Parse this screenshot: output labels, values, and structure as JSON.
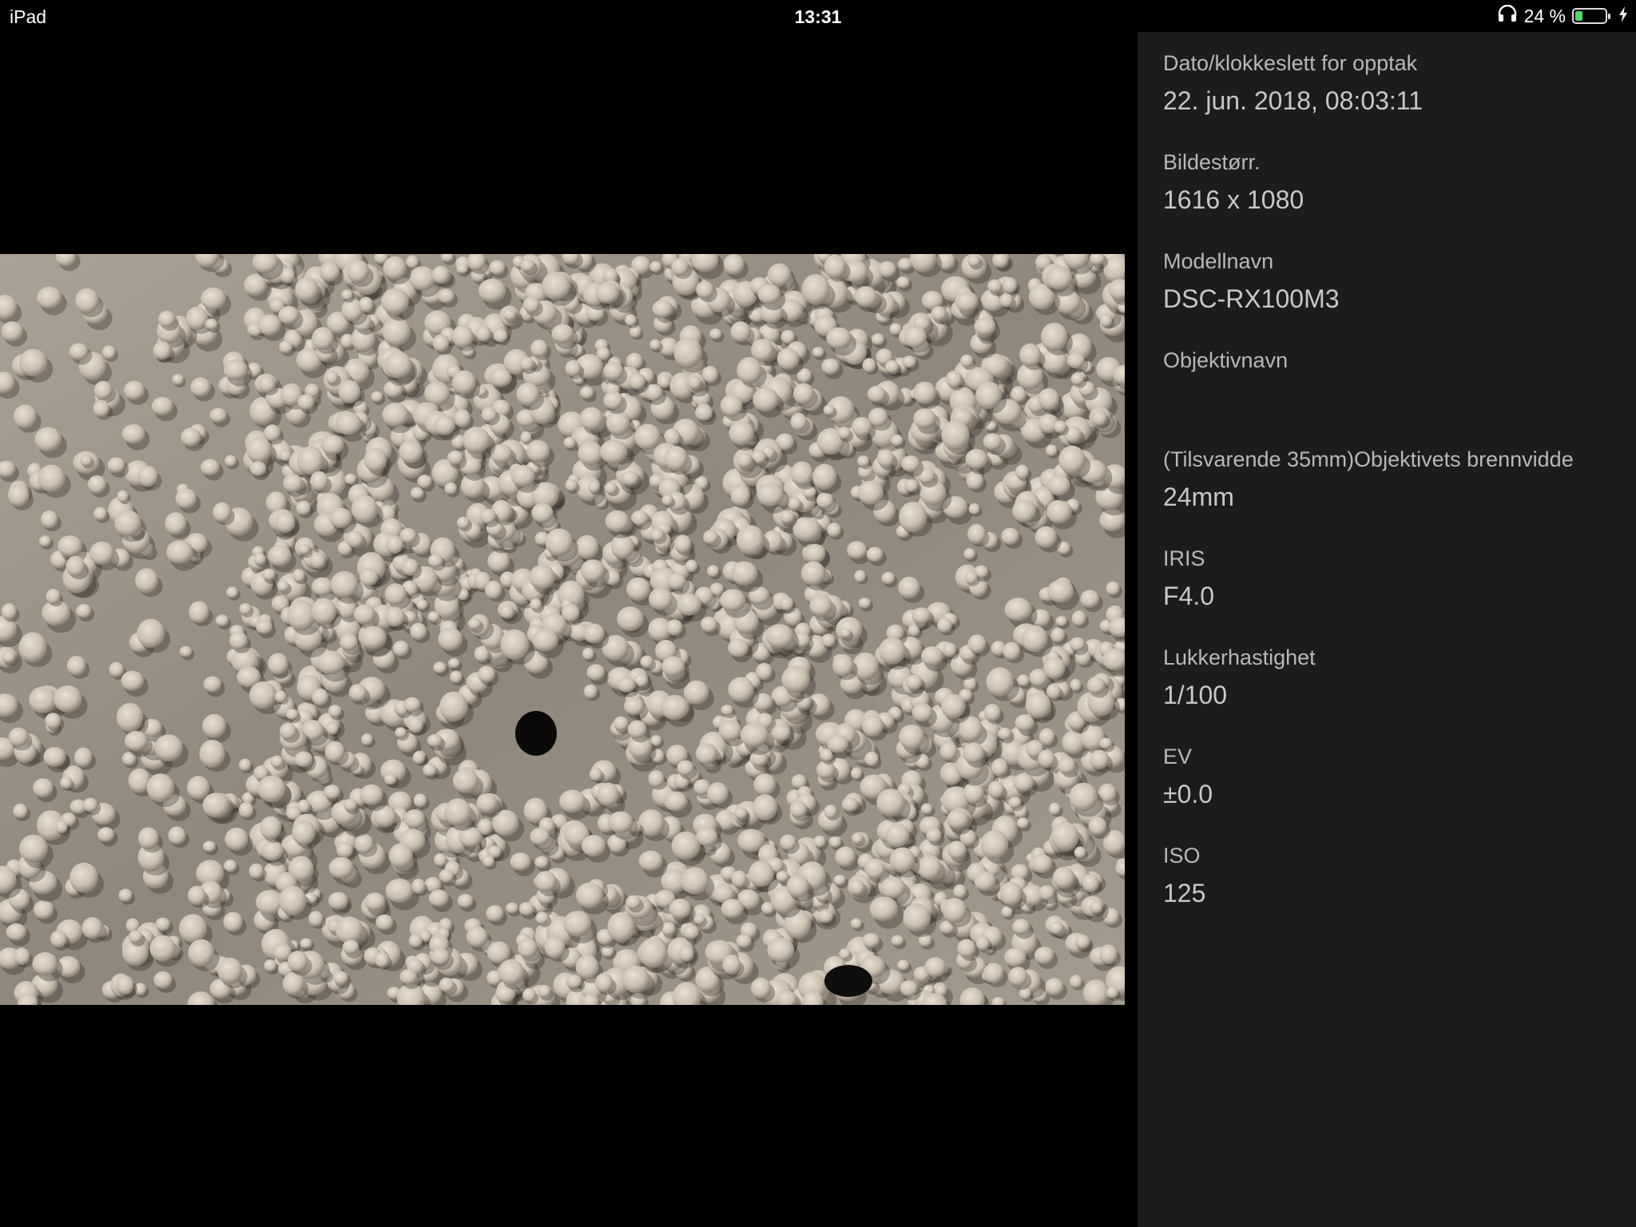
{
  "status_bar": {
    "device": "iPad",
    "time": "13:31",
    "battery_percent_label": "24 %",
    "battery_level": 0.24,
    "battery_color": "#4cd964"
  },
  "photo": {
    "description_icon": "photo-image"
  },
  "info": {
    "items": [
      {
        "label": "Dato/klokkeslett for opptak",
        "value": "22. jun. 2018, 08:03:11"
      },
      {
        "label": "Bildestørr.",
        "value": "1616 x 1080"
      },
      {
        "label": "Modellnavn",
        "value": "DSC-RX100M3"
      },
      {
        "label": "Objektivnavn",
        "value": ""
      },
      {
        "label": "(Tilsvarende 35mm)Objektivets brennvidde",
        "value": "24mm"
      },
      {
        "label": "IRIS",
        "value": "F4.0"
      },
      {
        "label": "Lukkerhastighet",
        "value": "1/100"
      },
      {
        "label": "EV",
        "value": "±0.0"
      },
      {
        "label": "ISO",
        "value": "125"
      }
    ]
  }
}
